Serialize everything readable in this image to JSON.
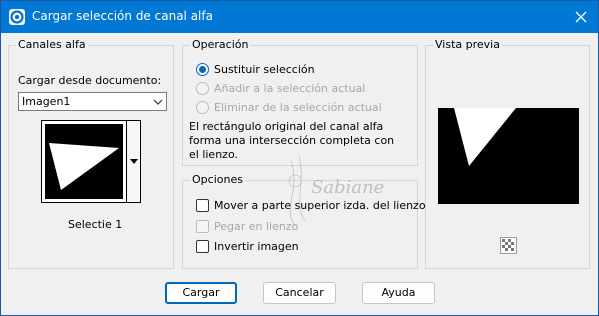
{
  "window": {
    "title": "Cargar selección de canal alfa"
  },
  "alpha_channels": {
    "group_label": "Canales alfa",
    "load_from_label": "Cargar desde documento:",
    "document_value": "Imagen1",
    "selection_name": "Selectie 1"
  },
  "operation": {
    "group_label": "Operación",
    "options": [
      {
        "label": "Sustituir selección",
        "checked": true,
        "enabled": true
      },
      {
        "label": "Añadir a la selección actual",
        "checked": false,
        "enabled": false
      },
      {
        "label": "Eliminar de la selección actual",
        "checked": false,
        "enabled": false
      }
    ],
    "description_lines": [
      "El rectángulo original del canal alfa",
      "forma una intersección completa con",
      "el lienzo."
    ]
  },
  "options": {
    "group_label": "Opciones",
    "move_top_left": {
      "label": "Mover a parte superior izda. del lienzo",
      "checked": false,
      "enabled": true
    },
    "paste_on_canvas": {
      "label": "Pegar en lienzo",
      "checked": false,
      "enabled": false
    },
    "invert_image": {
      "label": "Invertir imagen",
      "checked": false,
      "enabled": true
    }
  },
  "preview": {
    "group_label": "Vista previa",
    "toggle_icon": "checkerboard-icon"
  },
  "buttons": {
    "load": "Cargar",
    "cancel": "Cancelar",
    "help": "Ayuda"
  },
  "watermark_text": "Sabiane",
  "colors": {
    "titlebar": "#0078d4",
    "accent": "#0067c0",
    "disabled_text": "#a6a6a6"
  }
}
